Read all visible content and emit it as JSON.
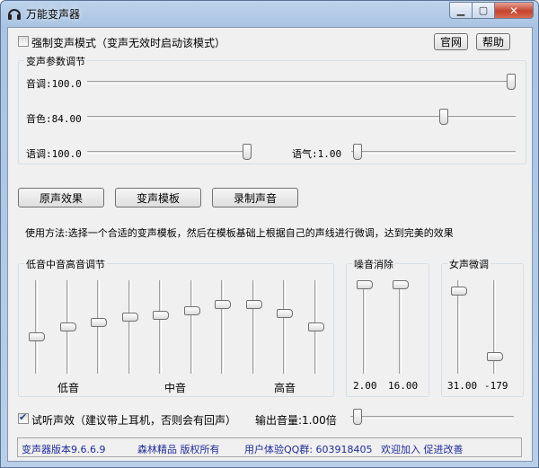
{
  "window": {
    "title": "万能变声器"
  },
  "top": {
    "force_mode": {
      "label": "强制变声模式（变声无效时启动该模式）",
      "checked": false
    },
    "website_label": "官网",
    "help_label": "帮助"
  },
  "params": {
    "group_label": "变声参数调节",
    "pitch": {
      "label": "音调:100.0",
      "value": 100.0
    },
    "timbre": {
      "label": "音色:84.00",
      "value": 84.0
    },
    "tone": {
      "label": "语调:100.0",
      "value": 100.0
    },
    "mood": {
      "label": "语气:1.00",
      "value": 1.0
    }
  },
  "actions": {
    "original_label": "原声效果",
    "template_label": "变声模板",
    "record_label": "录制声音"
  },
  "usage_text": "使用方法:选择一个合适的变声模板，然后在模板基础上根据自己的声线进行微调，达到完美的效果",
  "eq": {
    "group_label": "低音中音高音调节",
    "low_label": "低音",
    "mid_label": "中音",
    "high_label": "高音",
    "bands": [
      0.62,
      0.5,
      0.45,
      0.38,
      0.36,
      0.31,
      0.23,
      0.23,
      0.34,
      0.5
    ]
  },
  "noise": {
    "group_label": "噪音消除",
    "values": [
      {
        "label": "2.00",
        "level": 1.0
      },
      {
        "label": "16.00",
        "level": 1.0
      }
    ]
  },
  "female": {
    "group_label": "女声微调",
    "values": [
      {
        "label": "31.00",
        "level": 0.93
      },
      {
        "label": "-179",
        "level": 0.15
      }
    ]
  },
  "monitor": {
    "label": "试听声效（建议带上耳机，否则会有回声）",
    "checked": true
  },
  "output_volume": {
    "label": "输出音量:1.00倍",
    "value": 0.02
  },
  "status": {
    "version": "变声器版本9.6.6.9",
    "vendor": "森林精品 版权所有",
    "qq": "用户体验QQ群: 603918405",
    "join": "欢迎加入 促进改善"
  }
}
